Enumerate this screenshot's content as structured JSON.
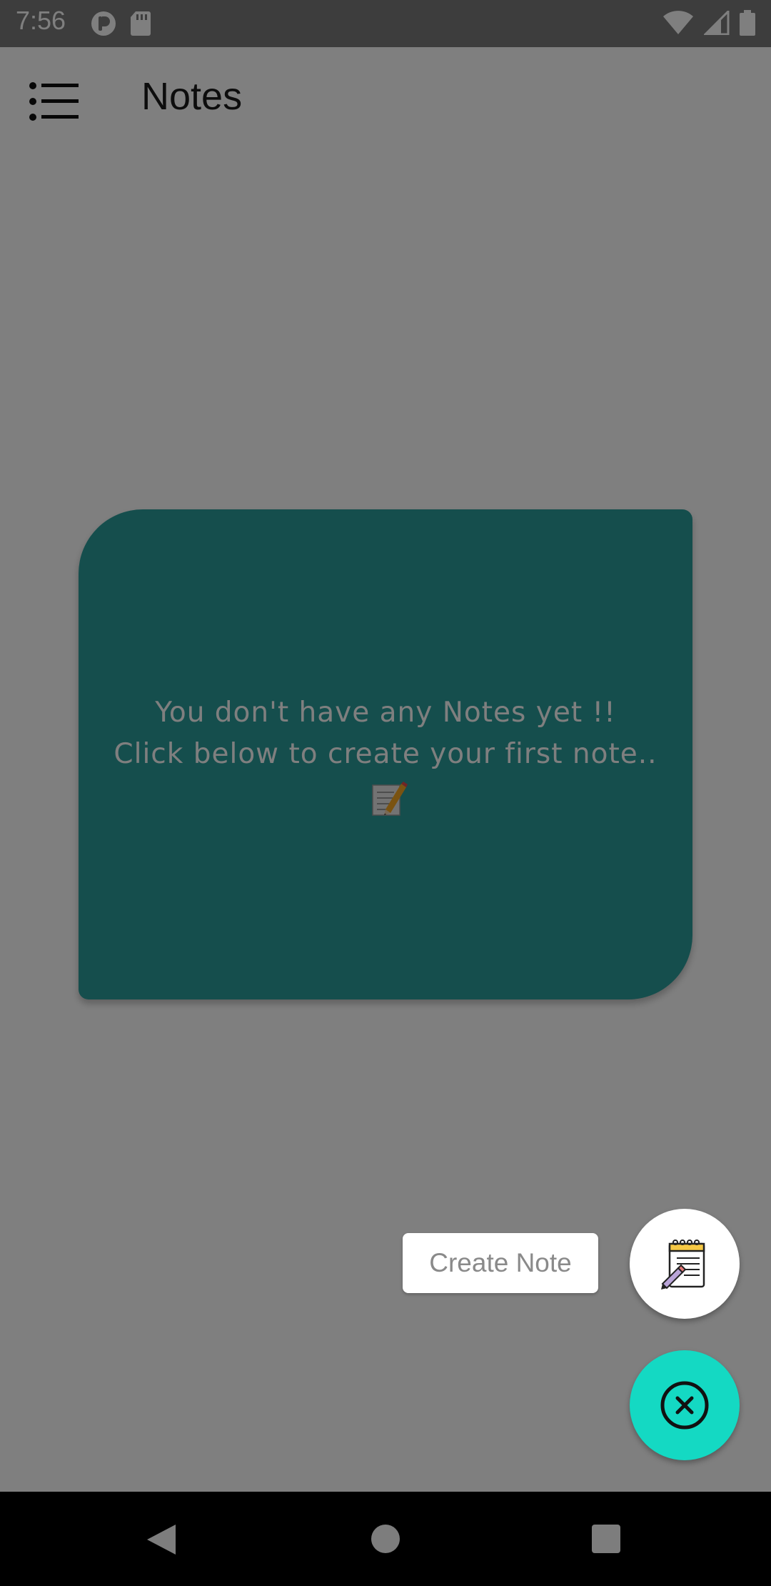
{
  "status_bar": {
    "time": "7:56",
    "left_icons": [
      "data-saver-icon",
      "sd-card-icon"
    ],
    "right_icons": [
      "wifi-icon",
      "cell-signal-icon",
      "battery-icon"
    ]
  },
  "app_bar": {
    "menu_icon": "list-menu-icon",
    "title": "Notes"
  },
  "empty_state": {
    "line1": "You don't have any Notes yet !!",
    "line2": "Click below to create your first note..",
    "emoji_icon": "memo-pencil-icon",
    "card_color": "#2a9d9a"
  },
  "speed_dial": {
    "create_label": "Create Note",
    "create_icon": "notepad-pencil-icon",
    "close_icon": "close-circle-icon",
    "close_fab_color": "#14d9c3"
  },
  "nav_bar": {
    "back_icon": "back-triangle-icon",
    "home_icon": "home-circle-icon",
    "recents_icon": "recents-square-icon"
  },
  "colors": {
    "scrim": "rgba(0,0,0,0.5)",
    "status_bar": "#7a7a7a",
    "nav_bar": "#000000"
  }
}
